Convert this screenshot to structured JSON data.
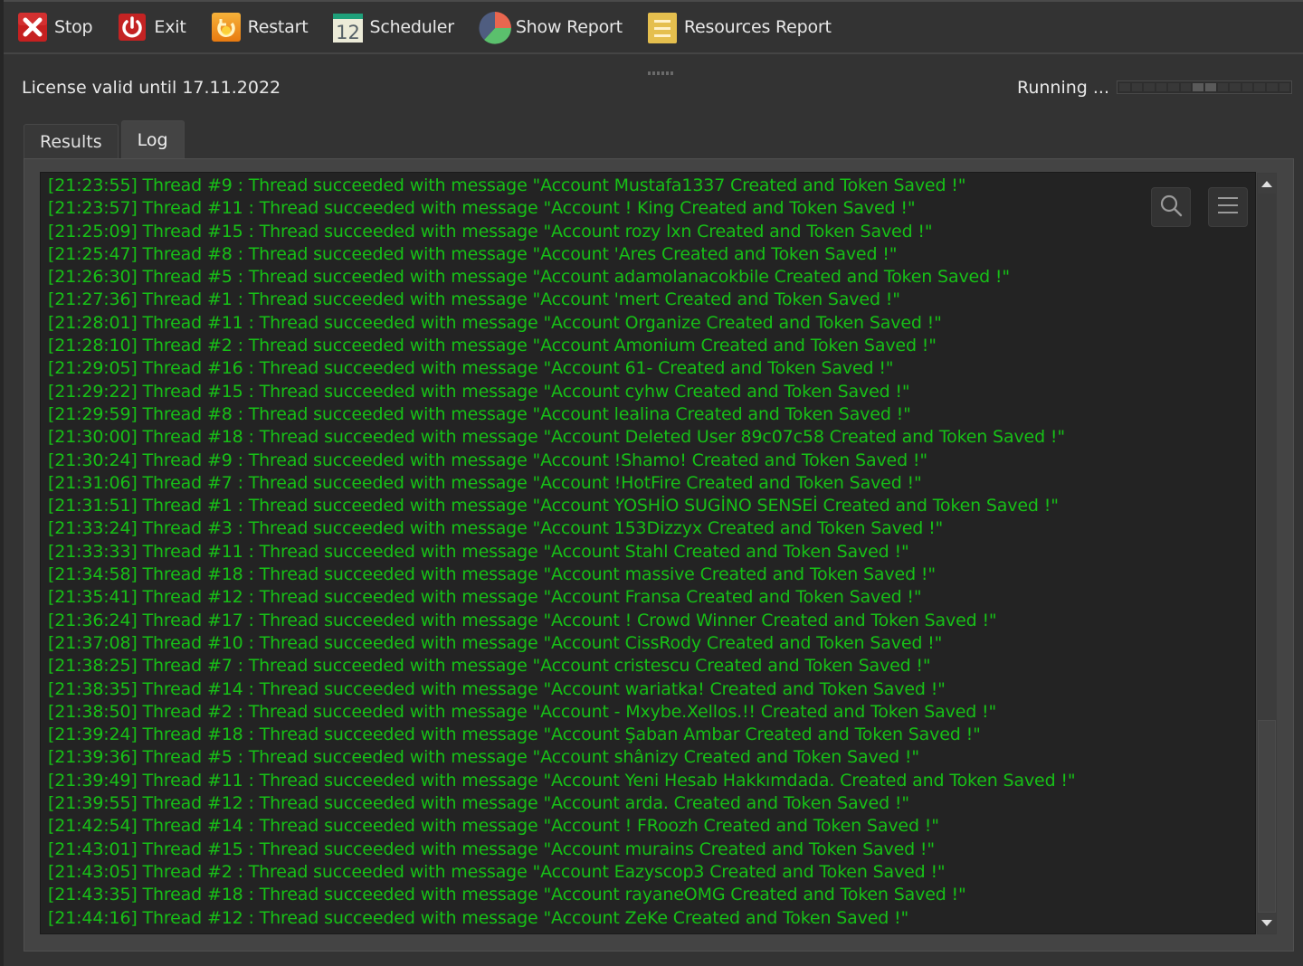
{
  "toolbar": {
    "buttons": [
      {
        "id": "stop",
        "label": "Stop",
        "icon": "stop-x-icon"
      },
      {
        "id": "exit",
        "label": "Exit",
        "icon": "power-icon"
      },
      {
        "id": "restart",
        "label": "Restart",
        "icon": "restart-icon"
      },
      {
        "id": "scheduler",
        "label": "Scheduler",
        "icon": "calendar-icon",
        "icon_text": "12"
      },
      {
        "id": "show-report",
        "label": "Show Report",
        "icon": "pie-chart-icon"
      },
      {
        "id": "resources-report",
        "label": "Resources Report",
        "icon": "list-doc-icon"
      }
    ]
  },
  "status": {
    "license": "License valid until 17.11.2022",
    "running": "Running ...",
    "progress_segments": 14,
    "progress_active": [
      6,
      7
    ]
  },
  "tabs": [
    {
      "label": "Results",
      "active": false
    },
    {
      "label": "Log",
      "active": true
    }
  ],
  "log": {
    "color": "#17c017",
    "lines": [
      "[21:23:55] Thread #9 : Thread succeeded with message \"Account Mustafa1337 Created and Token Saved !\"",
      "[21:23:57] Thread #11 : Thread succeeded with message \"Account ! King Created and Token Saved !\"",
      "[21:25:09] Thread #15 : Thread succeeded with message \"Account rozy lxn Created and Token Saved !\"",
      "[21:25:47] Thread #8 : Thread succeeded with message \"Account 'Ares Created and Token Saved !\"",
      "[21:26:30] Thread #5 : Thread succeeded with message \"Account adamolanacokbile Created and Token Saved !\"",
      "[21:27:36] Thread #1 : Thread succeeded with message \"Account 'mert Created and Token Saved !\"",
      "[21:28:01] Thread #11 : Thread succeeded with message \"Account Organize Created and Token Saved !\"",
      "[21:28:10] Thread #2 : Thread succeeded with message \"Account Amonium Created and Token Saved !\"",
      "[21:29:05] Thread #16 : Thread succeeded with message \"Account 61- Created and Token Saved !\"",
      "[21:29:22] Thread #15 : Thread succeeded with message \"Account cyhw Created and Token Saved !\"",
      "[21:29:59] Thread #8 : Thread succeeded with message \"Account lealina Created and Token Saved !\"",
      "[21:30:00] Thread #18 : Thread succeeded with message \"Account Deleted User 89c07c58 Created and Token Saved !\"",
      "[21:30:24] Thread #9 : Thread succeeded with message \"Account !Shamo! Created and Token Saved !\"",
      "[21:31:06] Thread #7 : Thread succeeded with message \"Account !HotFire Created and Token Saved !\"",
      "[21:31:51] Thread #1 : Thread succeeded with message \"Account YOSHİO SUGİNO SENSEİ Created and Token Saved !\"",
      "[21:33:24] Thread #3 : Thread succeeded with message \"Account 153Dizzyx Created and Token Saved !\"",
      "[21:33:33] Thread #11 : Thread succeeded with message \"Account Stahl Created and Token Saved !\"",
      "[21:34:58] Thread #18 : Thread succeeded with message \"Account massive Created and Token Saved !\"",
      "[21:35:41] Thread #12 : Thread succeeded with message \"Account Fransa Created and Token Saved !\"",
      "[21:36:24] Thread #17 : Thread succeeded with message \"Account ! Crowd Winner Created and Token Saved !\"",
      "[21:37:08] Thread #10 : Thread succeeded with message \"Account CissRody Created and Token Saved !\"",
      "[21:38:25] Thread #7 : Thread succeeded with message \"Account cristescu Created and Token Saved !\"",
      "[21:38:35] Thread #14 : Thread succeeded with message \"Account wariatka! Created and Token Saved !\"",
      "[21:38:50] Thread #2 : Thread succeeded with message \"Account - Mxybe.Xellos.!! Created and Token Saved !\"",
      "[21:39:24] Thread #18 : Thread succeeded with message \"Account Şaban Ambar Created and Token Saved !\"",
      "[21:39:36] Thread #5 : Thread succeeded with message \"Account shânizy Created and Token Saved !\"",
      "[21:39:49] Thread #11 : Thread succeeded with message \"Account Yeni Hesab Hakkımdada. Created and Token Saved !\"",
      "[21:39:55] Thread #12 : Thread succeeded with message \"Account arda. Created and Token Saved !\"",
      "[21:42:54] Thread #14 : Thread succeeded with message \"Account ! FRoozh Created and Token Saved !\"",
      "[21:43:01] Thread #15 : Thread succeeded with message \"Account murains Created and Token Saved !\"",
      "[21:43:05] Thread #2 : Thread succeeded with message \"Account Eazyscop3 Created and Token Saved !\"",
      "[21:43:35] Thread #18 : Thread succeeded with message \"Account rayaneOMG Created and Token Saved !\"",
      "[21:44:16] Thread #12 : Thread succeeded with message \"Account ZeKe Created and Token Saved !\""
    ],
    "search_button_icon": "search-icon",
    "menu_button_icon": "hamburger-menu-icon"
  }
}
